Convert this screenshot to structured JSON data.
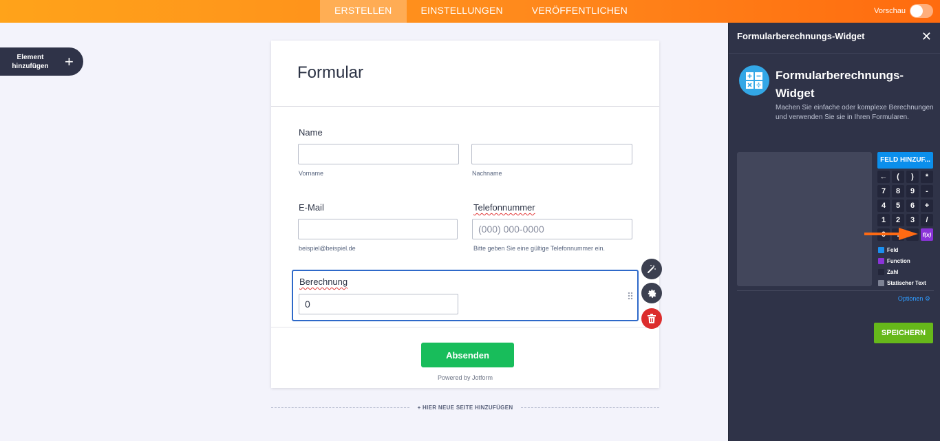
{
  "topbar": {
    "tabs": [
      "ERSTELLEN",
      "EINSTELLUNGEN",
      "VERÖFFENTLICHEN"
    ],
    "active_tab": "ERSTELLEN",
    "preview_label": "Vorschau"
  },
  "sidebar": {
    "add_element_label": "Element hinzufügen"
  },
  "form": {
    "title": "Formular",
    "name": {
      "label": "Name",
      "first_sublabel": "Vorname",
      "last_sublabel": "Nachname"
    },
    "email": {
      "label": "E-Mail",
      "sublabel": "beispiel@beispiel.de"
    },
    "phone": {
      "label": "Telefonnummer",
      "placeholder": "(000) 000-0000",
      "sublabel": "Bitte geben Sie eine gültige Telefonnummer ein."
    },
    "calc": {
      "label": "Berechnung",
      "value": "0"
    },
    "submit_label": "Absenden",
    "powered_by": "Powered by Jotform",
    "new_page_label": "+ HIER NEUE SEITE HINZUFÜGEN"
  },
  "panel": {
    "title": "Formularberechnungs-Widget",
    "widget_name": "Formularberechnungs-Widget",
    "description": "Machen Sie einfache oder komplexe Berechnungen und verwenden Sie sie in Ihren Formularen.",
    "add_field_label": "FELD HINZUF...",
    "keypad": [
      "←",
      "(",
      ")",
      "*",
      "7",
      "8",
      "9",
      "-",
      "4",
      "5",
      "6",
      "+",
      "1",
      "2",
      "3",
      "/",
      "0",
      ".",
      "",
      "f(x)"
    ],
    "legend": [
      {
        "label": "Feld",
        "color": "#1b8fef"
      },
      {
        "label": "Function",
        "color": "#8a33d8"
      },
      {
        "label": "Zahl",
        "color": "#23263a"
      },
      {
        "label": "Statischer Text",
        "color": "#7d8294"
      }
    ],
    "options_label": "Optionen",
    "save_label": "SPEICHERN"
  },
  "colors": {
    "accent_orange": "#ff8a1c",
    "submit_green": "#18bd5b",
    "save_green": "#66b81a",
    "panel_bg": "#2f3348",
    "focus_blue": "#2e69c9"
  }
}
